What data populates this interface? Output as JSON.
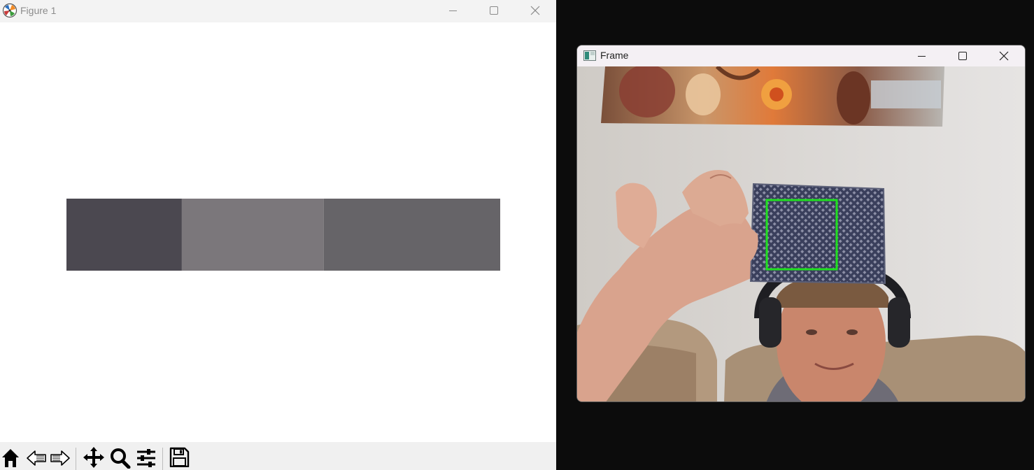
{
  "figure_window": {
    "title": "Figure 1",
    "color_swatches": [
      {
        "color": "#4b4850",
        "width_fraction": 0.266
      },
      {
        "color": "#7b777b",
        "width_fraction": 0.327
      },
      {
        "color": "#666468",
        "width_fraction": 0.407
      }
    ],
    "toolbar": {
      "buttons": [
        "home-icon",
        "back-icon",
        "forward-icon",
        "pan-icon",
        "zoom-icon",
        "configure-subplots-icon",
        "save-icon"
      ]
    }
  },
  "frame_window": {
    "title": "Frame",
    "detection_box_color": "#1fe01f"
  },
  "colors": {
    "desktop": "#0c0c0c",
    "titlebar_inactive": "#f3f3f3",
    "titlebar_active": "#f4f0f4"
  }
}
